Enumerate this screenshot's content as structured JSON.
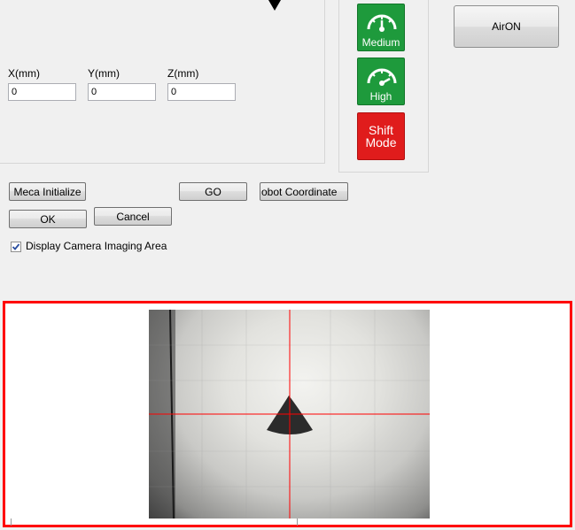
{
  "coords": {
    "x_label": "X(mm)",
    "y_label": "Y(mm)",
    "z_label": "Z(mm)",
    "x_value": "0",
    "y_value": "0",
    "z_value": "0"
  },
  "speed": {
    "medium_label": "Medium",
    "high_label": "High",
    "shift_label_line1": "Shift",
    "shift_label_line2": "Mode"
  },
  "buttons": {
    "air_on": "AirON",
    "meca_initialize": "Meca Initialize",
    "go": "GO",
    "robot_coordinate": "obot Coordinate",
    "ok": "OK",
    "cancel": "Cancel"
  },
  "display_camera": {
    "label": "Display Camera Imaging Area",
    "checked": true
  },
  "colors": {
    "speed_green": "#1e9a3c",
    "shift_red": "#e01c1c",
    "frame_red": "#ff0000",
    "crosshair": "#ff0000"
  }
}
